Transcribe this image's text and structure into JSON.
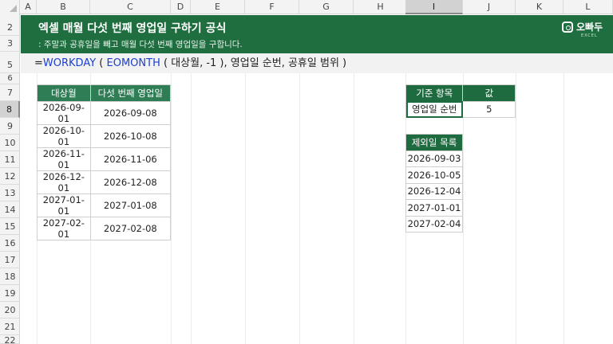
{
  "columns": [
    "A",
    "B",
    "C",
    "D",
    "E",
    "F",
    "G",
    "H",
    "I",
    "J",
    "K",
    "L"
  ],
  "selected_column": "I",
  "rows": [
    "2",
    "3",
    "5",
    "6",
    "7",
    "8",
    "9",
    "10",
    "11",
    "12",
    "13",
    "14",
    "15",
    "16",
    "17",
    "18",
    "19",
    "20",
    "21",
    "22"
  ],
  "selected_row": "8",
  "banner": {
    "title": "엑셀 매월 다섯 번째 영업일 구하기 공식",
    "subtitle": ": 주말과 공휴일을 빼고 매월 다섯 번째 영업일을 구합니다.",
    "logo_text": "오빠두",
    "logo_sub": "EXCEL"
  },
  "formula": {
    "prefix": "=",
    "fn1": "WORKDAY",
    "part1": " ( ",
    "fn2": "EOMONTH",
    "part2": " ( 대상월, -1 ), 영업일 순번, 공휴일 범위 )"
  },
  "table_left": {
    "headers": [
      "대상월",
      "다섯 번째 영업일"
    ],
    "rows": [
      [
        "2026-09-01",
        "2026-09-08"
      ],
      [
        "2026-10-01",
        "2026-10-08"
      ],
      [
        "2026-11-01",
        "2026-11-06"
      ],
      [
        "2026-12-01",
        "2026-12-08"
      ],
      [
        "2027-01-01",
        "2027-01-08"
      ],
      [
        "2027-02-01",
        "2027-02-08"
      ]
    ]
  },
  "table_criteria": {
    "headers": [
      "기준 항목",
      "값"
    ],
    "rows": [
      [
        "영업일 순번",
        "5"
      ]
    ]
  },
  "table_holidays": {
    "header": "제외일 목록",
    "rows": [
      "2026-09-03",
      "2026-10-05",
      "2026-12-04",
      "2027-01-01",
      "2027-02-04"
    ]
  },
  "colors": {
    "banner": "#1f6e3f",
    "header_green": "#2e7d55",
    "header_dark": "#1e6b40",
    "function_blue": "#1b3fd0"
  }
}
